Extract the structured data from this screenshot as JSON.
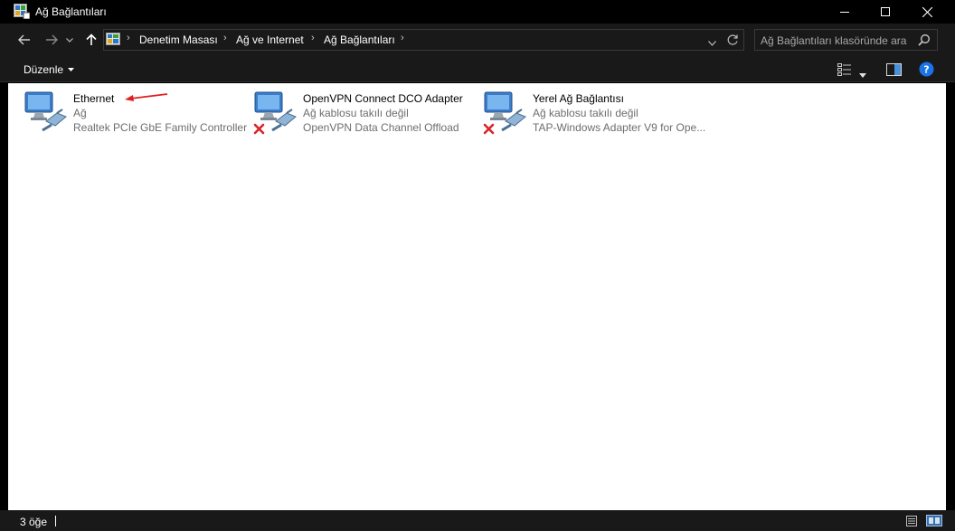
{
  "window": {
    "title": "Ağ Bağlantıları"
  },
  "breadcrumb": {
    "items": [
      "Denetim Masası",
      "Ağ ve Internet",
      "Ağ Bağlantıları"
    ]
  },
  "search": {
    "placeholder": "Ağ Bağlantıları klasöründe ara"
  },
  "toolbar": {
    "organize_label": "Düzenle"
  },
  "connections": [
    {
      "name": "Ethernet",
      "status": "Ağ",
      "device": "Realtek PCIe GbE Family Controller",
      "disconnected": false
    },
    {
      "name": "OpenVPN Connect DCO Adapter",
      "status": "Ağ kablosu takılı değil",
      "device": "OpenVPN Data Channel Offload",
      "disconnected": true
    },
    {
      "name": "Yerel Ağ Bağlantısı",
      "status": "Ağ kablosu takılı değil",
      "device": "TAP-Windows Adapter V9 for Ope...",
      "disconnected": true
    }
  ],
  "statusbar": {
    "item_count": "3 öğe"
  },
  "colors": {
    "chrome_bg": "#191919",
    "titlebar_bg": "#000000",
    "content_bg": "#ffffff",
    "help_blue": "#1a73e8",
    "annotation_red": "#e02020",
    "error_red": "#d9242a"
  }
}
